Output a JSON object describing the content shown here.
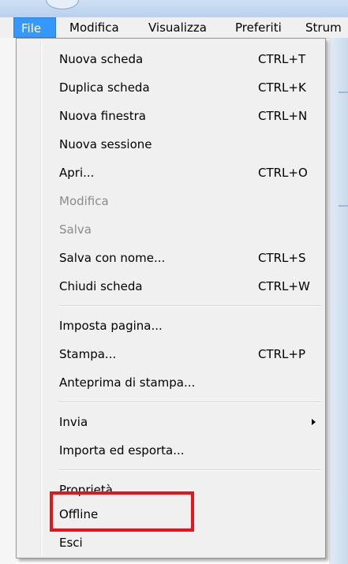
{
  "menubar": {
    "items": [
      {
        "label": "File",
        "active": true
      },
      {
        "label": "Modifica"
      },
      {
        "label": "Visualizza"
      },
      {
        "label": "Preferiti"
      },
      {
        "label": "Strum"
      }
    ]
  },
  "file_menu": {
    "items": [
      {
        "label": "Nuova scheda",
        "shortcut": "CTRL+T"
      },
      {
        "label": "Duplica scheda",
        "shortcut": "CTRL+K"
      },
      {
        "label": "Nuova finestra",
        "shortcut": "CTRL+N"
      },
      {
        "label": "Nuova sessione",
        "shortcut": ""
      },
      {
        "label": "Apri...",
        "shortcut": "CTRL+O"
      },
      {
        "label": "Modifica",
        "shortcut": "",
        "disabled": true
      },
      {
        "label": "Salva",
        "shortcut": "",
        "disabled": true
      },
      {
        "label": "Salva con nome...",
        "shortcut": "CTRL+S"
      },
      {
        "label": "Chiudi scheda",
        "shortcut": "CTRL+W"
      },
      {
        "label": "Imposta pagina...",
        "shortcut": ""
      },
      {
        "label": "Stampa...",
        "shortcut": "CTRL+P"
      },
      {
        "label": "Anteprima di stampa...",
        "shortcut": ""
      },
      {
        "label": "Invia",
        "shortcut": "",
        "submenu": true
      },
      {
        "label": "Importa ed esporta...",
        "shortcut": ""
      },
      {
        "label": "Proprietà",
        "shortcut": ""
      },
      {
        "label": "Offline",
        "shortcut": "",
        "highlighted": true
      },
      {
        "label": "Esci",
        "shortcut": ""
      }
    ]
  },
  "colors": {
    "menubar_active_bg": "#3399ff",
    "highlight_box": "#e8141b",
    "disabled_text": "#8b8b8b"
  },
  "icons": {
    "submenu_arrow": "chevron-right-icon"
  }
}
